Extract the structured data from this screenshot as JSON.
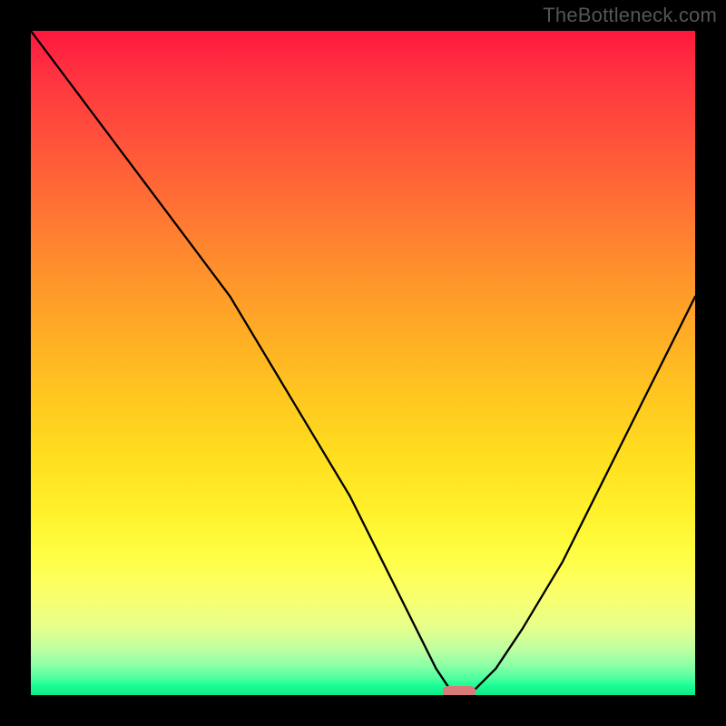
{
  "watermark": "TheBottleneck.com",
  "chart_data": {
    "type": "line",
    "title": "",
    "xlabel": "",
    "ylabel": "",
    "xlim": [
      0,
      100
    ],
    "ylim": [
      0,
      100
    ],
    "grid": false,
    "legend": false,
    "series": [
      {
        "name": "bottleneck-curve",
        "x": [
          0,
          6,
          12,
          18,
          24,
          30,
          36,
          42,
          48,
          54,
          58,
          61,
          63,
          65,
          67,
          70,
          74,
          80,
          86,
          92,
          98,
          100
        ],
        "y": [
          100,
          92,
          84,
          76,
          68,
          60,
          50,
          40,
          30,
          18,
          10,
          4,
          1,
          0,
          1,
          4,
          10,
          20,
          32,
          44,
          56,
          60
        ]
      }
    ],
    "marker": {
      "name": "bottleneck-point",
      "x_range": [
        62,
        67
      ],
      "y": 0,
      "color": "#d97b78"
    },
    "background": {
      "type": "vertical-gradient",
      "stops": [
        {
          "pos": 0.0,
          "color": "#ff173e"
        },
        {
          "pos": 0.5,
          "color": "#ffbf22"
        },
        {
          "pos": 0.8,
          "color": "#fffd3f"
        },
        {
          "pos": 0.95,
          "color": "#8cffa6"
        },
        {
          "pos": 1.0,
          "color": "#10e88a"
        }
      ]
    }
  }
}
